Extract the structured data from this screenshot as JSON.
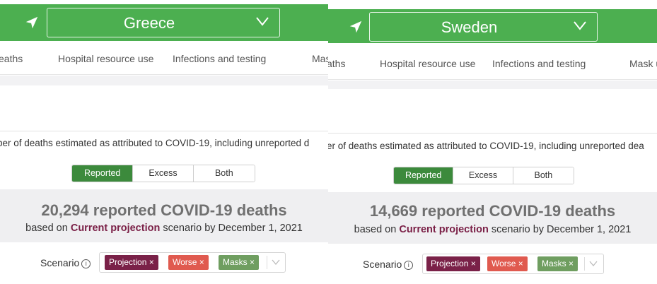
{
  "colors": {
    "header_green": "#4caf50",
    "active_green": "#3c8a3c",
    "projection": "#7a2148",
    "worse": "#e05a4f",
    "masks": "#6f9e60"
  },
  "icons": {
    "location": "location-arrow-icon",
    "chevron": "chevron-down-icon",
    "info": "info-circle-icon",
    "remove": "x-icon"
  },
  "left": {
    "country": "Greece",
    "nav": [
      "eaths",
      "Hospital resource use",
      "Infections and testing",
      "Mas"
    ],
    "description": "ber of deaths estimated as attributed to COVID-19, including unreported d",
    "toggle": [
      "Reported",
      "Excess",
      "Both"
    ],
    "headline_number": "20,294",
    "headline_text": "reported COVID-19 deaths",
    "based_on": "based on",
    "scenario_name": "Current projection",
    "scenario_suffix": "scenario by December 1, 2021",
    "scenario_label": "Scenario",
    "chips": [
      "Projection ×",
      "Worse ×",
      "Masks ×"
    ]
  },
  "right": {
    "country": "Sweden",
    "nav": [
      "aths",
      "Hospital resource use",
      "Infections and testing",
      "Mask u"
    ],
    "description": "er of deaths estimated as attributed to COVID-19, including unreported dea",
    "toggle": [
      "Reported",
      "Excess",
      "Both"
    ],
    "headline_number": "14,669",
    "headline_text": "reported COVID-19 deaths",
    "based_on": "based on",
    "scenario_name": "Current projection",
    "scenario_suffix": "scenario by December 1, 2021",
    "scenario_label": "Scenario",
    "chips": [
      "Projection ×",
      "Worse ×",
      "Masks ×"
    ]
  }
}
